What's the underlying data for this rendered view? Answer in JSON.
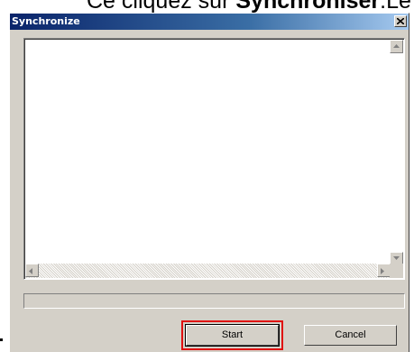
{
  "caption": {
    "prefix": "Ce cliquez sur ",
    "bold": "Synchroniser",
    "suffix": ".Le d"
  },
  "window": {
    "title": "Synchronize",
    "close_icon": "close-icon"
  },
  "log": {
    "content": ""
  },
  "progress": {
    "value": 0
  },
  "buttons": {
    "start": "Start",
    "cancel": "Cancel"
  },
  "colors": {
    "title_bar_start": "#0a246a",
    "title_bar_end": "#a6caf0",
    "dialog_face": "#d4d0c8",
    "highlight": "#e01010"
  }
}
